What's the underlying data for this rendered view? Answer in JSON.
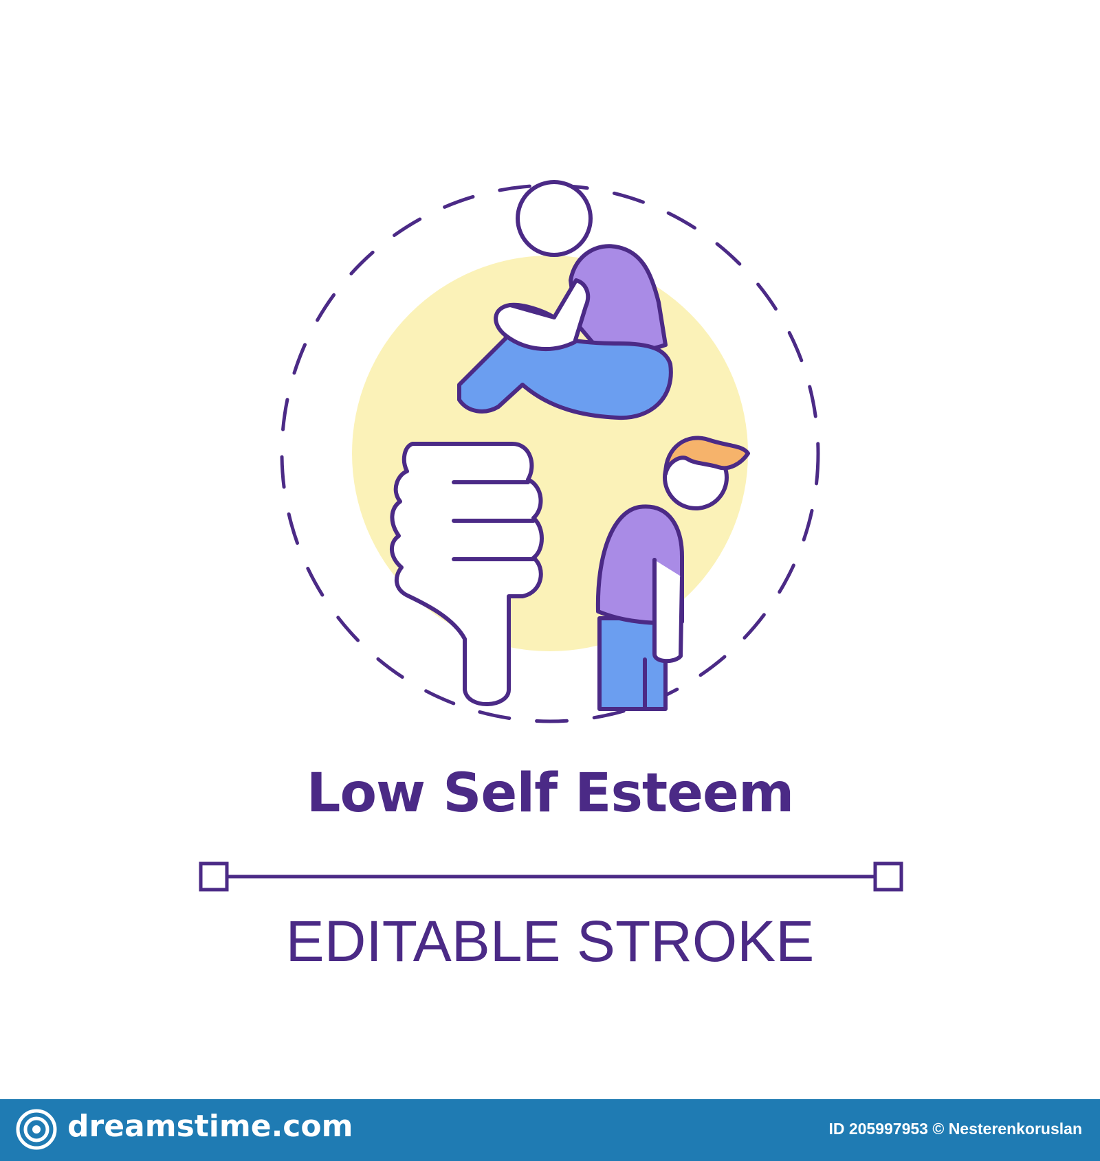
{
  "title": "Low Self Esteem",
  "subtitle": "EDITABLE STROKE",
  "footer": {
    "brand": "dreamstime.com",
    "credit": "ID 205997953 © Nesterenkoruslan"
  },
  "colors": {
    "outline": "#4b2a86",
    "backdrop": "#fbf2b8",
    "shirt": "#a98be6",
    "pants": "#6b9ef0",
    "hair": "#f6b36b",
    "footer": "#1f7bb3"
  },
  "icons": [
    "sitting-person-icon",
    "thumbs-down-icon",
    "standing-person-icon",
    "dreamstime-logo-icon"
  ]
}
